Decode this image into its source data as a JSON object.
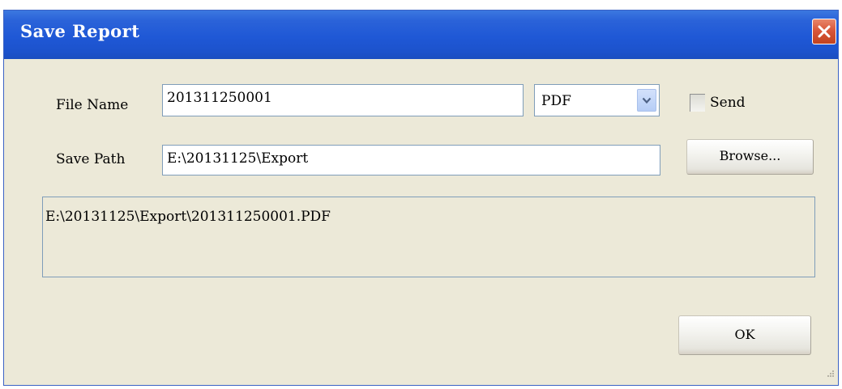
{
  "window": {
    "title": "Save Report"
  },
  "form": {
    "file_name_label": "File Name",
    "file_name_value": "201311250001",
    "format_selected": "PDF",
    "send_label": "Send",
    "send_checked": false,
    "save_path_label": "Save Path",
    "save_path_value": "E:\\20131125\\Export",
    "browse_label": "Browse...",
    "full_path": "E:\\20131125\\Export\\201311250001.PDF"
  },
  "footer": {
    "ok_label": "OK"
  },
  "icons": {
    "close": "close-icon",
    "dropdown": "chevron-down-icon",
    "resize": "resize-grip-icon"
  },
  "colors": {
    "titlebar": "#1F58D6",
    "close_button": "#D9573A",
    "dialog_background": "#ECE9D8",
    "field_border": "#7F9DB9"
  }
}
